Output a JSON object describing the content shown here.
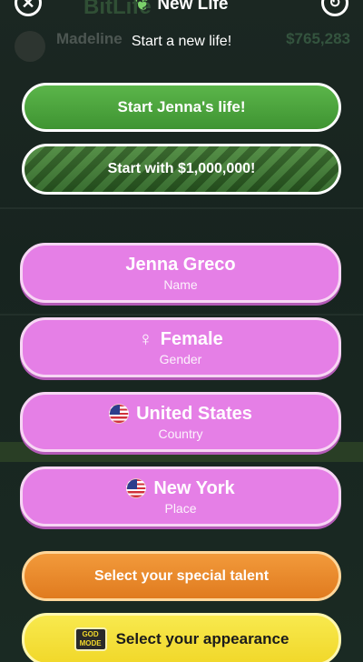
{
  "header": {
    "title": "New Life",
    "subtitle": "Start a new life!",
    "close_icon": "close-icon",
    "refresh_icon": "refresh-icon",
    "title_icon": "sprout-icon"
  },
  "background": {
    "logo": "BitLife",
    "profile_name": "Madeline",
    "money": "$765,283"
  },
  "actions": {
    "start_life": "Start Jenna's life!",
    "start_money": "Start with $1,000,000!"
  },
  "fields": {
    "name": {
      "value": "Jenna Greco",
      "label": "Name"
    },
    "gender": {
      "value": "Female",
      "label": "Gender",
      "symbol": "♀"
    },
    "country": {
      "value": "United States",
      "label": "Country"
    },
    "place": {
      "value": "New York",
      "label": "Place"
    }
  },
  "extras": {
    "talent": "Select your special talent",
    "appearance": "Select your appearance",
    "godmode_top": "GOD",
    "godmode_bottom": "MODE"
  },
  "colors": {
    "green": "#4aa23b",
    "pink": "#e57fe6",
    "orange": "#eb8a2c",
    "yellow": "#f4df36"
  }
}
